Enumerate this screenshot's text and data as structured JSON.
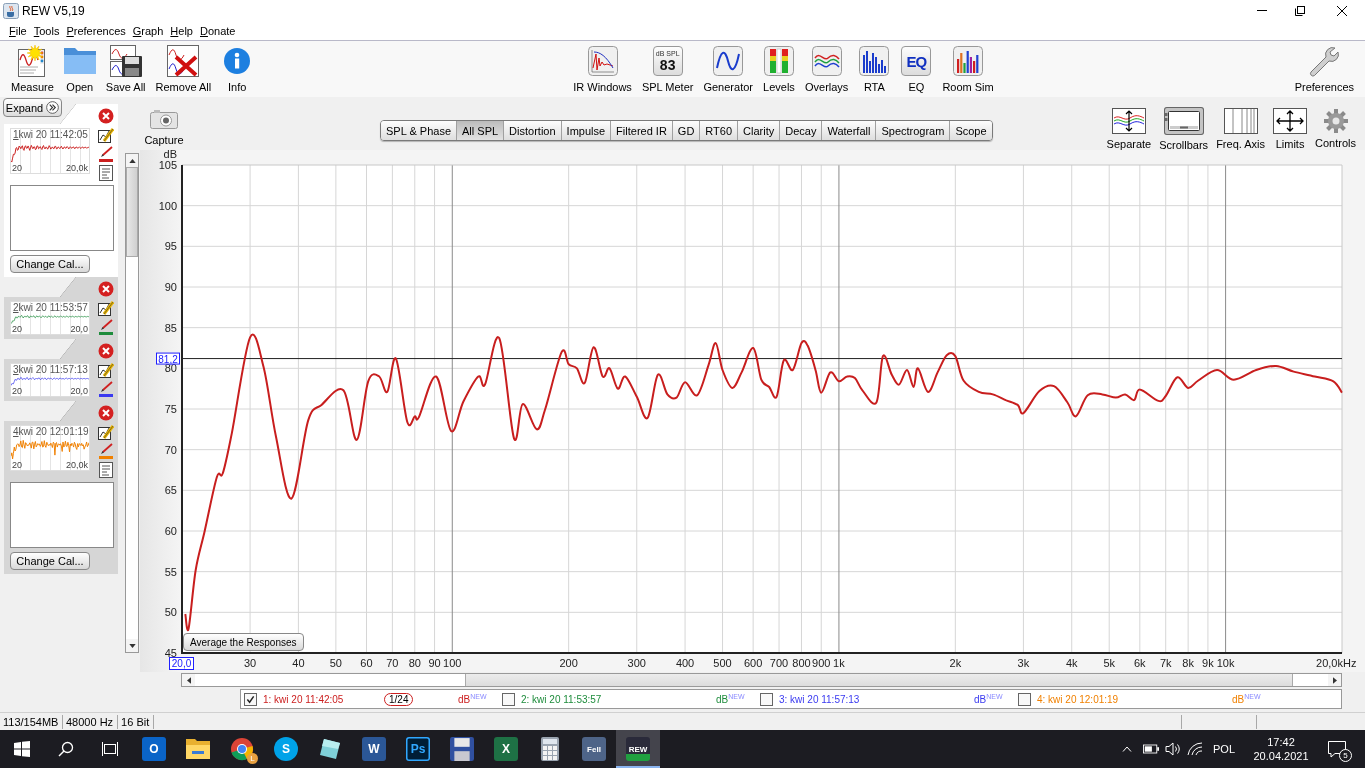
{
  "window": {
    "title": "REW V5,19"
  },
  "menu": [
    "File",
    "Tools",
    "Preferences",
    "Graph",
    "Help",
    "Donate"
  ],
  "toolbar": {
    "left": [
      {
        "label": "Measure"
      },
      {
        "label": "Open"
      },
      {
        "label": "Save All"
      },
      {
        "label": "Remove All"
      },
      {
        "label": "Info"
      }
    ],
    "center": [
      {
        "label": "IR Windows"
      },
      {
        "label": "SPL Meter",
        "icon_text": [
          "dB SPL",
          "83"
        ]
      },
      {
        "label": "Generator"
      },
      {
        "label": "Levels"
      },
      {
        "label": "Overlays"
      },
      {
        "label": "RTA"
      },
      {
        "label": "EQ",
        "icon_text": [
          "EQ"
        ]
      },
      {
        "label": "Room Sim"
      }
    ],
    "right": [
      {
        "label": "Preferences"
      }
    ]
  },
  "measurements_panel": {
    "expand_button": "Expand",
    "measurements": [
      {
        "number": "1",
        "name": "kwi 20 11:42:05",
        "color": "#cc2020",
        "selected": true,
        "expanded": true,
        "axis_start": "20",
        "axis_end": "20,0k",
        "button": "Change Cal..."
      },
      {
        "number": "2",
        "name": "kwi 20 11:53:57",
        "color": "#1e8c3c",
        "selected": false,
        "expanded": false,
        "axis_start": "20",
        "axis_end": "20,0"
      },
      {
        "number": "3",
        "name": "kwi 20 11:57:13",
        "color": "#3a3af0",
        "selected": false,
        "expanded": false,
        "axis_start": "20",
        "axis_end": "20,0"
      },
      {
        "number": "4",
        "name": "kwi 20 12:01:19",
        "color": "#f08000",
        "selected": false,
        "expanded": true,
        "axis_start": "20",
        "axis_end": "20,0k",
        "button": "Change Cal..."
      }
    ]
  },
  "graph": {
    "capture_button": "Capture",
    "tabs": [
      {
        "label": "SPL & Phase",
        "selected": false
      },
      {
        "label": "All SPL",
        "selected": true
      },
      {
        "label": "Distortion",
        "selected": false
      },
      {
        "label": "Impulse",
        "selected": false
      },
      {
        "label": "Filtered IR",
        "selected": false
      },
      {
        "label": "GD",
        "selected": false
      },
      {
        "label": "RT60",
        "selected": false
      },
      {
        "label": "Clarity",
        "selected": false
      },
      {
        "label": "Decay",
        "selected": false
      },
      {
        "label": "Waterfall",
        "selected": false
      },
      {
        "label": "Spectrogram",
        "selected": false
      },
      {
        "label": "Scope",
        "selected": false
      }
    ],
    "controls": [
      {
        "label": "Separate",
        "selected": false
      },
      {
        "label": "Scrollbars",
        "selected": true
      },
      {
        "label": "Freq. Axis",
        "selected": false
      },
      {
        "label": "Limits",
        "selected": false
      },
      {
        "label": "Controls",
        "selected": false
      }
    ],
    "average_button": "Average the Responses",
    "chart_data": {
      "type": "line",
      "xlabel": "Hz",
      "ylabel": "dB",
      "log": "x",
      "grid": true,
      "x": [
        20.4,
        20.8,
        21.7,
        22.9,
        24.6,
        25.5,
        26.9,
        30,
        32.5,
        35,
        38.4,
        42.4,
        45.9,
        52.3,
        56.6,
        60.6,
        64.7,
        67.9,
        71.5,
        76.5,
        80,
        82,
        90.8,
        99.3,
        106.8,
        116.8,
        121.5,
        132.3,
        144.4,
        152.1,
        165.3,
        173.7,
        191.8,
        200,
        210,
        220,
        232,
        245,
        255,
        268,
        280,
        300,
        320,
        340,
        360,
        380,
        400,
        430,
        460,
        480,
        500,
        530,
        560,
        600,
        630,
        660,
        690,
        720,
        760,
        800,
        830,
        870,
        900,
        950,
        1000,
        1050,
        1100,
        1150,
        1250,
        1300,
        1370,
        1430,
        1500,
        1560,
        1600,
        1700,
        1800,
        1900,
        2000,
        2100,
        2300,
        2500,
        2700,
        2900,
        3000,
        3300,
        3600,
        3900,
        4100,
        4400,
        4800,
        5200,
        5500,
        5800,
        6000,
        6700,
        7000,
        7500,
        8000,
        8500,
        9500,
        10500,
        12000,
        13500,
        15000,
        17000,
        19000,
        20000
      ],
      "series": [
        {
          "color": "#c81e1e",
          "values": [
            49.8,
            48,
            55.2,
            60,
            66.6,
            67.1,
            72,
            83.8,
            80.2,
            71.6,
            64,
            73.6,
            75.5,
            77.3,
            71.2,
            78.4,
            79,
            77.1,
            81.2,
            73.4,
            74.1,
            74,
            79,
            72.3,
            75.9,
            79,
            78,
            83.7,
            71.4,
            75.6,
            72.5,
            74.9,
            82,
            80.5,
            80,
            78.2,
            82.6,
            79,
            80,
            77.5,
            79,
            76.5,
            73.9,
            79.2,
            76.8,
            76.4,
            78.3,
            76.7,
            80.4,
            83.1,
            79.8,
            77.6,
            79.5,
            82.5,
            78.6,
            77.7,
            76.5,
            81,
            79.8,
            83.1,
            82.8,
            79.8,
            77,
            79.5,
            78.4,
            79,
            78.8,
            77.3,
            75.8,
            81.5,
            79.2,
            78,
            79.8,
            77.7,
            80,
            77.1,
            79.5,
            81.6,
            81.5,
            78.5,
            77.1,
            76.8,
            76.1,
            75.5,
            74.5,
            77.2,
            77.8,
            75.8,
            74.1,
            76.7,
            76.8,
            76.4,
            76.8,
            76.1,
            77.4,
            76,
            76.6,
            78.9,
            77.6,
            78.5,
            79.8,
            78.6,
            79.8,
            80.3,
            79.6,
            79,
            78.4,
            77
          ]
        }
      ],
      "xlim": [
        20,
        20000
      ],
      "ylim": [
        45,
        105
      ],
      "xticks": [
        30,
        40,
        50,
        60,
        70,
        80,
        90,
        100,
        200,
        300,
        400,
        500,
        600,
        700,
        800,
        900,
        {
          "value": 1000,
          "label": "1k"
        },
        {
          "value": 2000,
          "label": "2k"
        },
        {
          "value": 3000,
          "label": "3k"
        },
        {
          "value": 4000,
          "label": "4k"
        },
        {
          "value": 5000,
          "label": "5k"
        },
        {
          "value": 6000,
          "label": "6k"
        },
        {
          "value": 7000,
          "label": "7k"
        },
        {
          "value": 8000,
          "label": "8k"
        },
        {
          "value": 9000,
          "label": "9k"
        },
        {
          "value": 10000,
          "label": "10k"
        },
        {
          "value": 20000,
          "label": "20,0k"
        }
      ],
      "yticks": [
        45,
        50,
        55,
        60,
        65,
        70,
        75,
        80,
        85,
        90,
        95,
        100,
        105
      ],
      "ref_lines": [
        {
          "axis": "y",
          "value": 81.2,
          "label": "81,2"
        }
      ],
      "annotations": [
        "20,0"
      ]
    }
  },
  "legend": [
    {
      "checked": true,
      "label": "1: kwi 20 11:42:05",
      "smoothing": "1/24",
      "unit": "dB$^{NEW}$"
    },
    {
      "checked": false,
      "label": "2: kwi 20 11:53:57",
      "unit": "dB$^{NEW}$"
    },
    {
      "checked": false,
      "label": "3: kwi 20 11:57:13",
      "unit": "dB$^{NEW}$"
    },
    {
      "checked": false,
      "label": "4: kwi 20 12:01:19",
      "unit": "dB$^{NEW}$"
    }
  ],
  "status_bar": [
    "113/154MB",
    "48000 Hz",
    "16 Bit"
  ],
  "taskbar": {
    "apps": [
      {
        "selected": false,
        "text": "O"
      },
      {
        "selected": false
      },
      {
        "selected": false,
        "badge": "L"
      },
      {
        "selected": false,
        "text": "S"
      },
      {
        "selected": false
      },
      {
        "selected": false,
        "text": "W"
      },
      {
        "selected": false,
        "text": "Ps"
      },
      {
        "selected": false
      },
      {
        "selected": false,
        "text": "X"
      },
      {
        "selected": false
      },
      {
        "selected": false,
        "text": "FeII"
      },
      {
        "selected": true,
        "text": "REW"
      }
    ],
    "language": "POL",
    "time": "17:42",
    "date": "20.04.2021",
    "notifications": "5"
  }
}
